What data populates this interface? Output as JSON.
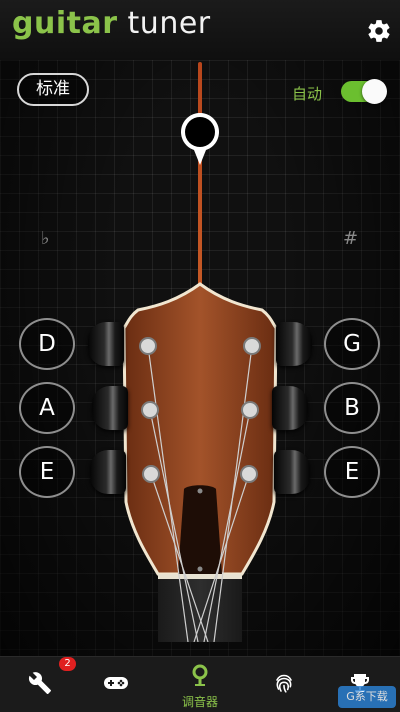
{
  "header": {
    "title_part1": "guitar",
    "title_part2": "tuner",
    "brand_color": "#8bc34a",
    "settings_icon": "gear-icon"
  },
  "controls": {
    "mode_button": "标准",
    "auto_label": "自动",
    "auto_enabled": true,
    "flat_symbol": "♭",
    "sharp_symbol": "#"
  },
  "strings": {
    "left": [
      "D",
      "A",
      "E"
    ],
    "right": [
      "G",
      "B",
      "E"
    ]
  },
  "bottom_nav": {
    "items": [
      {
        "icon": "wrench-icon",
        "label": ""
      },
      {
        "icon": "gamepad-icon",
        "label": ""
      },
      {
        "icon": "tuner-pin-icon",
        "label": "调音器",
        "active": true
      },
      {
        "icon": "fingerprint-icon",
        "label": ""
      },
      {
        "icon": "trophy-icon",
        "label": ""
      }
    ],
    "badge_count": "2",
    "accent_color": "#8bc34a"
  },
  "watermark": "G系下载"
}
